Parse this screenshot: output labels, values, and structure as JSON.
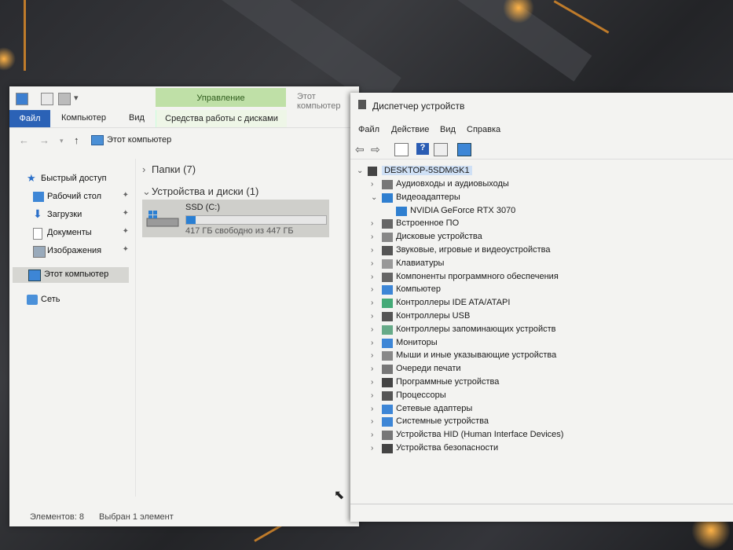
{
  "explorer": {
    "ribbon_ctx_title": "Управление",
    "window_title": "Этот компьютер",
    "tabs": [
      "Файл",
      "Компьютер",
      "Вид",
      "Средства работы с дисками"
    ],
    "address": "Этот компьютер",
    "nav": [
      {
        "label": "Быстрый доступ",
        "icon": "star-icon"
      },
      {
        "label": "Рабочий стол",
        "icon": "desktop-icon",
        "pinned": true
      },
      {
        "label": "Загрузки",
        "icon": "download-icon",
        "pinned": true
      },
      {
        "label": "Документы",
        "icon": "document-icon",
        "pinned": true
      },
      {
        "label": "Изображения",
        "icon": "image-icon",
        "pinned": true
      },
      {
        "label": "Этот компьютер",
        "icon": "computer-icon",
        "selected": true
      },
      {
        "label": "Сеть",
        "icon": "network-icon"
      }
    ],
    "groups": {
      "folders": "Папки (7)",
      "devices": "Устройства и диски (1)"
    },
    "drive": {
      "name": "SSD (C:)",
      "free_text": "417 ГБ свободно из 447 ГБ",
      "used_fraction": 0.067
    },
    "status": {
      "items": "Элементов: 8",
      "selected": "Выбран 1 элемент"
    },
    "colors": {
      "file_tab": "#2b62b6",
      "ctx_tab": "#bfe0a7",
      "drive_bar": "#2a7fd3"
    }
  },
  "devmgr": {
    "title": "Диспетчер устройств",
    "menu": [
      "Файл",
      "Действие",
      "Вид",
      "Справка"
    ],
    "root": "DESKTOP-5SDMGK1",
    "nodes": [
      {
        "label": "Аудиовходы и аудиовыходы",
        "icon": "audio-icon",
        "expanded": false
      },
      {
        "label": "Видеоадаптеры",
        "icon": "display-adapter-icon",
        "expanded": true
      },
      {
        "label": "NVIDIA GeForce RTX 3070",
        "icon": "display-adapter-icon",
        "child": true
      },
      {
        "label": "Встроенное ПО",
        "icon": "firmware-icon",
        "expanded": false
      },
      {
        "label": "Дисковые устройства",
        "icon": "disk-icon",
        "expanded": false
      },
      {
        "label": "Звуковые, игровые и видеоустройства",
        "icon": "sound-icon",
        "expanded": false
      },
      {
        "label": "Клавиатуры",
        "icon": "keyboard-icon",
        "expanded": false
      },
      {
        "label": "Компоненты программного обеспечения",
        "icon": "software-icon",
        "expanded": false
      },
      {
        "label": "Компьютер",
        "icon": "computer-icon",
        "expanded": false
      },
      {
        "label": "Контроллеры IDE ATA/ATAPI",
        "icon": "ide-icon",
        "expanded": false
      },
      {
        "label": "Контроллеры USB",
        "icon": "usb-icon",
        "expanded": false
      },
      {
        "label": "Контроллеры запоминающих устройств",
        "icon": "storage-icon",
        "expanded": false
      },
      {
        "label": "Мониторы",
        "icon": "monitor-icon",
        "expanded": false
      },
      {
        "label": "Мыши и иные указывающие устройства",
        "icon": "mouse-icon",
        "expanded": false
      },
      {
        "label": "Очереди печати",
        "icon": "printer-icon",
        "expanded": false
      },
      {
        "label": "Программные устройства",
        "icon": "software-device-icon",
        "expanded": false
      },
      {
        "label": "Процессоры",
        "icon": "processor-icon",
        "expanded": false
      },
      {
        "label": "Сетевые адаптеры",
        "icon": "network-adapter-icon",
        "expanded": false
      },
      {
        "label": "Системные устройства",
        "icon": "system-icon",
        "expanded": false
      },
      {
        "label": "Устройства HID (Human Interface Devices)",
        "icon": "hid-icon",
        "expanded": false
      },
      {
        "label": "Устройства безопасности",
        "icon": "security-icon",
        "expanded": false
      }
    ]
  }
}
